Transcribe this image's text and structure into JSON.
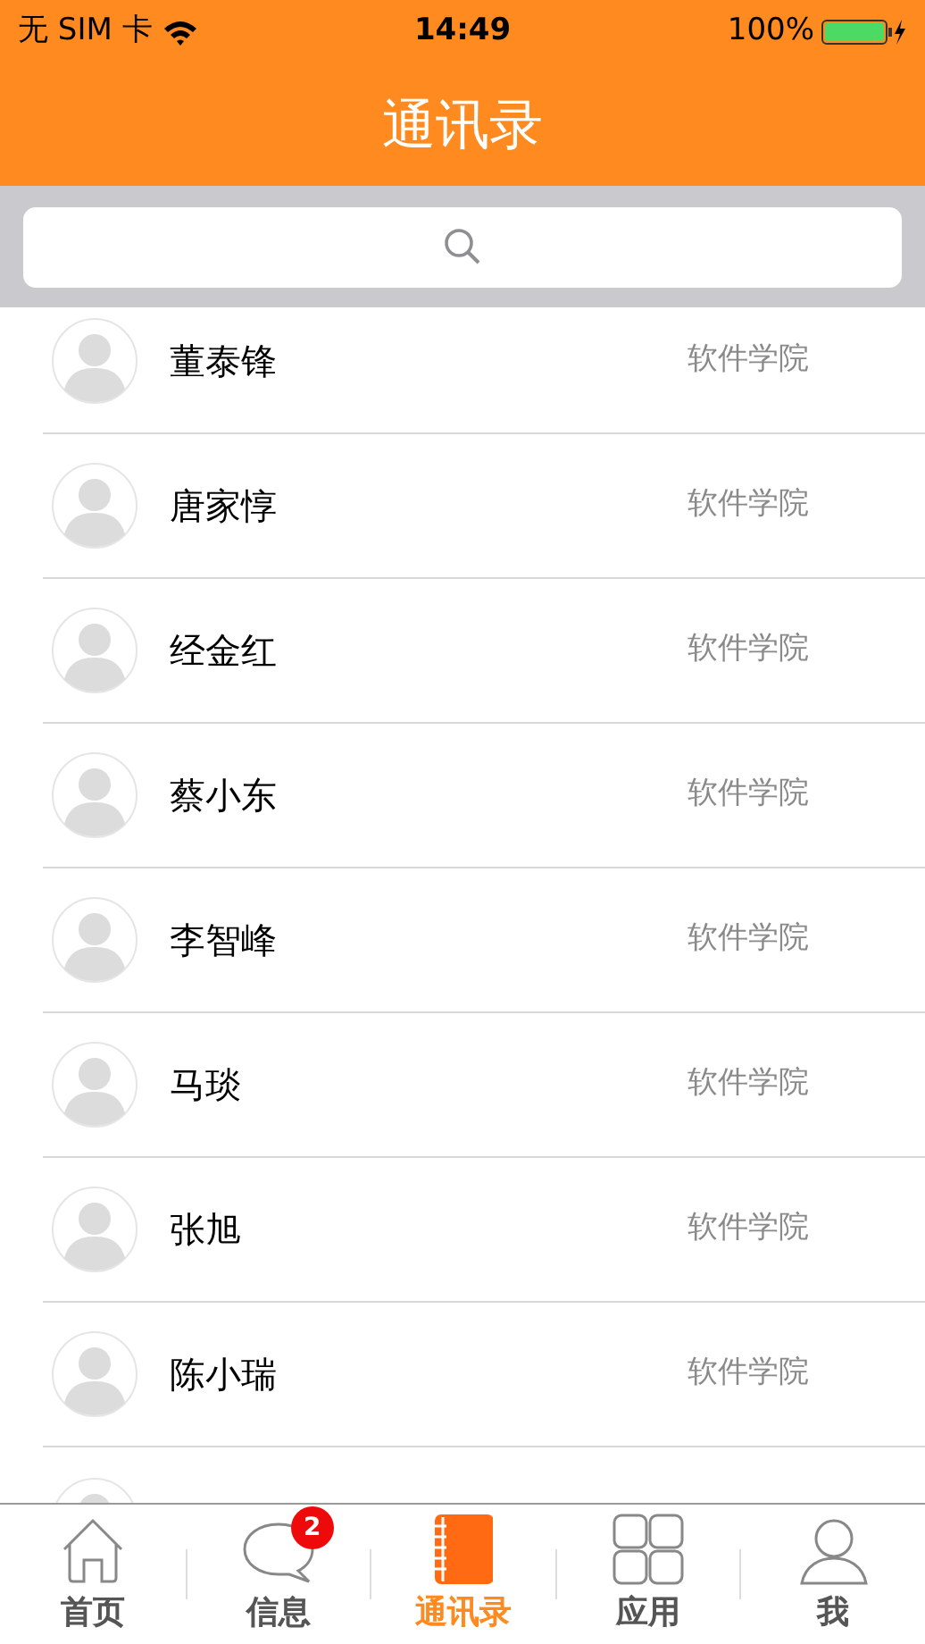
{
  "status_bar": {
    "carrier": "无 SIM 卡",
    "time": "14:49",
    "battery": "100%"
  },
  "nav": {
    "title": "通讯录"
  },
  "contacts": [
    {
      "name": "董泰锋",
      "department": "软件学院"
    },
    {
      "name": "唐家惇",
      "department": "软件学院"
    },
    {
      "name": "经金红",
      "department": "软件学院"
    },
    {
      "name": "蔡小东",
      "department": "软件学院"
    },
    {
      "name": "李智峰",
      "department": "软件学院"
    },
    {
      "name": "马琰",
      "department": "软件学院"
    },
    {
      "name": "张旭",
      "department": "软件学院"
    },
    {
      "name": "陈小瑞",
      "department": "软件学院"
    }
  ],
  "tabs": [
    {
      "kind": "home",
      "label": "首页",
      "selected": false
    },
    {
      "kind": "messages",
      "label": "信息",
      "selected": false,
      "badge": "2"
    },
    {
      "kind": "contacts",
      "label": "通讯录",
      "selected": true
    },
    {
      "kind": "apps",
      "label": "应用",
      "selected": false
    },
    {
      "kind": "me",
      "label": "我",
      "selected": false
    }
  ]
}
